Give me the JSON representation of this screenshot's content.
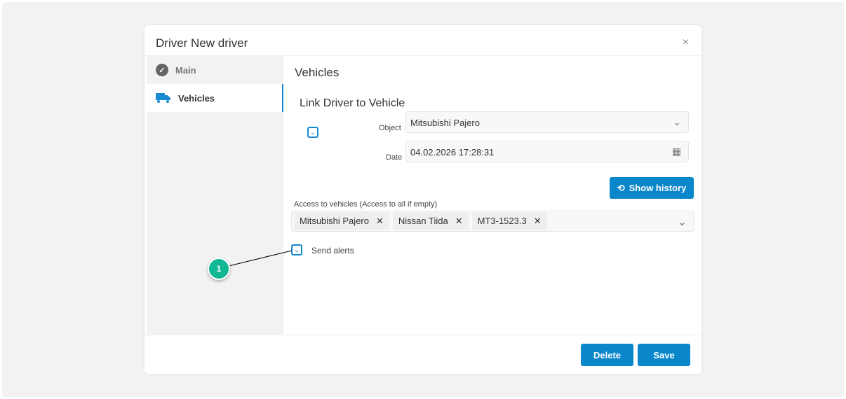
{
  "dialog": {
    "title": "Driver New driver",
    "close_icon": "×"
  },
  "sidebar": {
    "items": [
      {
        "label": "Main",
        "icon": "check-circle-icon"
      },
      {
        "label": "Vehicles",
        "icon": "truck-icon"
      }
    ]
  },
  "main": {
    "heading": "Vehicles",
    "section_title": "Link Driver to Vehicle",
    "object_label": "Object",
    "object_value": "Mitsubishi Pajero",
    "date_label": "Date",
    "date_value": "04.02.2026 17:28:31",
    "show_history": "Show history",
    "access_label": "Access to vehicles (Access to all if empty)",
    "access_tags": [
      "Mitsubishi Pajero",
      "Nissan Tiida",
      "MT3-1523.3"
    ],
    "send_alerts": "Send alerts"
  },
  "footer": {
    "delete": "Delete",
    "save": "Save"
  },
  "annotation": {
    "number": "1"
  },
  "colors": {
    "accent": "#0a86cb",
    "badge": "#12b894"
  }
}
